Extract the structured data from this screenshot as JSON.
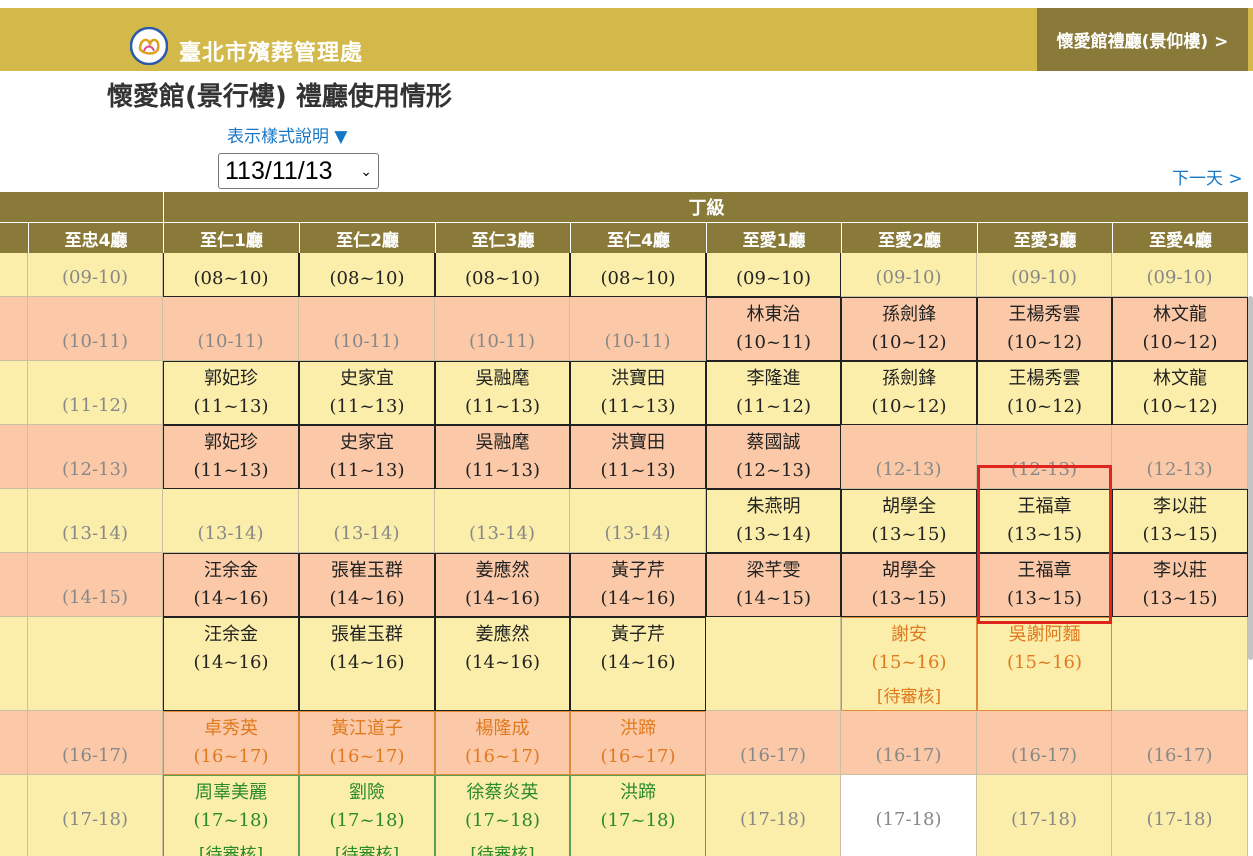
{
  "header": {
    "org_name": "臺北市殯葬管理處",
    "nav_link": "懷愛館禮廳(景仰樓) >",
    "page_title": "懷愛館(景行樓) 禮廳使用情形",
    "legend_link": "表示樣式說明 ▼",
    "date_value": "113/11/13",
    "next_day": "下一天 >"
  },
  "colors": {
    "topbar": "#d3b84a",
    "header_dark": "#8a7a3a",
    "row_yellow": "#fbeeab",
    "row_salmon": "#fbc9a8",
    "highlight": "#e0241f",
    "link": "#1677c6"
  },
  "table": {
    "grade_label": "丁級",
    "halls": [
      "至忠4廳",
      "至仁1廳",
      "至仁2廳",
      "至仁3廳",
      "至仁4廳",
      "至愛1廳",
      "至愛2廳",
      "至愛3廳",
      "至愛4廳"
    ],
    "rows": [
      {
        "bg": "yellow",
        "cells": [
          {
            "name": "",
            "time": "(09-10)",
            "style": "empty"
          },
          {
            "name": "",
            "time": "(08~10)",
            "style": "booked"
          },
          {
            "name": "",
            "time": "(08~10)",
            "style": "booked"
          },
          {
            "name": "",
            "time": "(08~10)",
            "style": "booked"
          },
          {
            "name": "",
            "time": "(08~10)",
            "style": "booked"
          },
          {
            "name": "",
            "time": "(09~10)",
            "style": "booked"
          },
          {
            "name": "",
            "time": "(09-10)",
            "style": "empty"
          },
          {
            "name": "",
            "time": "(09-10)",
            "style": "empty"
          },
          {
            "name": "",
            "time": "(09-10)",
            "style": "empty"
          }
        ]
      },
      {
        "bg": "salmon",
        "cells": [
          {
            "name": "",
            "time": "(10-11)",
            "style": "empty"
          },
          {
            "name": "",
            "time": "(10-11)",
            "style": "empty"
          },
          {
            "name": "",
            "time": "(10-11)",
            "style": "empty"
          },
          {
            "name": "",
            "time": "(10-11)",
            "style": "empty"
          },
          {
            "name": "",
            "time": "(10-11)",
            "style": "empty"
          },
          {
            "name": "林東治",
            "time": "(10~11)",
            "style": "booked"
          },
          {
            "name": "孫劍鋒",
            "time": "(10~12)",
            "style": "booked"
          },
          {
            "name": "王楊秀雲",
            "time": "(10~12)",
            "style": "booked"
          },
          {
            "name": "林文龍",
            "time": "(10~12)",
            "style": "booked"
          }
        ]
      },
      {
        "bg": "yellow",
        "cells": [
          {
            "name": "",
            "time": "(11-12)",
            "style": "empty"
          },
          {
            "name": "郭妃珍",
            "time": "(11~13)",
            "style": "booked"
          },
          {
            "name": "史家宜",
            "time": "(11~13)",
            "style": "booked"
          },
          {
            "name": "吳融麾",
            "time": "(11~13)",
            "style": "booked"
          },
          {
            "name": "洪寶田",
            "time": "(11~13)",
            "style": "booked"
          },
          {
            "name": "李隆進",
            "time": "(11~12)",
            "style": "booked"
          },
          {
            "name": "孫劍鋒",
            "time": "(10~12)",
            "style": "booked"
          },
          {
            "name": "王楊秀雲",
            "time": "(10~12)",
            "style": "booked"
          },
          {
            "name": "林文龍",
            "time": "(10~12)",
            "style": "booked"
          }
        ]
      },
      {
        "bg": "salmon",
        "cells": [
          {
            "name": "",
            "time": "(12-13)",
            "style": "empty"
          },
          {
            "name": "郭妃珍",
            "time": "(11~13)",
            "style": "booked"
          },
          {
            "name": "史家宜",
            "time": "(11~13)",
            "style": "booked"
          },
          {
            "name": "吳融麾",
            "time": "(11~13)",
            "style": "booked"
          },
          {
            "name": "洪寶田",
            "time": "(11~13)",
            "style": "booked"
          },
          {
            "name": "蔡國誠",
            "time": "(12~13)",
            "style": "booked"
          },
          {
            "name": "",
            "time": "(12-13)",
            "style": "empty"
          },
          {
            "name": "",
            "time": "(12-13)",
            "style": "empty"
          },
          {
            "name": "",
            "time": "(12-13)",
            "style": "empty"
          }
        ]
      },
      {
        "bg": "yellow",
        "cells": [
          {
            "name": "",
            "time": "(13-14)",
            "style": "empty"
          },
          {
            "name": "",
            "time": "(13-14)",
            "style": "empty"
          },
          {
            "name": "",
            "time": "(13-14)",
            "style": "empty"
          },
          {
            "name": "",
            "time": "(13-14)",
            "style": "empty"
          },
          {
            "name": "",
            "time": "(13-14)",
            "style": "empty"
          },
          {
            "name": "朱燕明",
            "time": "(13~14)",
            "style": "booked"
          },
          {
            "name": "胡學全",
            "time": "(13~15)",
            "style": "booked"
          },
          {
            "name": "王福章",
            "time": "(13~15)",
            "style": "booked"
          },
          {
            "name": "李以莊",
            "time": "(13~15)",
            "style": "booked"
          }
        ]
      },
      {
        "bg": "salmon",
        "cells": [
          {
            "name": "",
            "time": "(14-15)",
            "style": "empty"
          },
          {
            "name": "汪余金",
            "time": "(14~16)",
            "style": "booked"
          },
          {
            "name": "張崔玉群",
            "time": "(14~16)",
            "style": "booked"
          },
          {
            "name": "姜應然",
            "time": "(14~16)",
            "style": "booked"
          },
          {
            "name": "黃子芹",
            "time": "(14~16)",
            "style": "booked"
          },
          {
            "name": "梁芊雯",
            "time": "(14~15)",
            "style": "booked"
          },
          {
            "name": "胡學全",
            "time": "(13~15)",
            "style": "booked"
          },
          {
            "name": "王福章",
            "time": "(13~15)",
            "style": "booked"
          },
          {
            "name": "李以莊",
            "time": "(13~15)",
            "style": "booked"
          }
        ]
      },
      {
        "bg": "yellow",
        "tall": true,
        "cells": [
          {
            "name": "",
            "time": "",
            "style": "empty"
          },
          {
            "name": "汪余金",
            "time": "(14~16)",
            "style": "booked"
          },
          {
            "name": "張崔玉群",
            "time": "(14~16)",
            "style": "booked"
          },
          {
            "name": "姜應然",
            "time": "(14~16)",
            "style": "booked"
          },
          {
            "name": "黃子芹",
            "time": "(14~16)",
            "style": "booked"
          },
          {
            "name": "",
            "time": "",
            "style": "empty"
          },
          {
            "name": "謝安",
            "time": "(15~16)",
            "style": "pending",
            "status": "[待審核]"
          },
          {
            "name": "吳謝阿麵",
            "time": "(15~16)",
            "style": "pending"
          },
          {
            "name": "",
            "time": "",
            "style": "empty"
          }
        ]
      },
      {
        "bg": "salmon",
        "cells": [
          {
            "name": "",
            "time": "(16-17)",
            "style": "empty"
          },
          {
            "name": "卓秀英",
            "time": "(16~17)",
            "style": "pending"
          },
          {
            "name": "黃江道子",
            "time": "(16~17)",
            "style": "pending"
          },
          {
            "name": "楊隆成",
            "time": "(16~17)",
            "style": "pending"
          },
          {
            "name": "洪蹄",
            "time": "(16~17)",
            "style": "pending"
          },
          {
            "name": "",
            "time": "(16-17)",
            "style": "empty"
          },
          {
            "name": "",
            "time": "(16-17)",
            "style": "empty"
          },
          {
            "name": "",
            "time": "(16-17)",
            "style": "empty"
          },
          {
            "name": "",
            "time": "(16-17)",
            "style": "empty"
          }
        ]
      },
      {
        "bg": "yellow",
        "tall": true,
        "cells": [
          {
            "name": "",
            "time": "(17-18)",
            "style": "empty"
          },
          {
            "name": "周辜美麗",
            "time": "(17~18)",
            "style": "green",
            "status": "[待審核]"
          },
          {
            "name": "劉險",
            "time": "(17~18)",
            "style": "green",
            "status": "[待審核]"
          },
          {
            "name": "徐蔡炎英",
            "time": "(17~18)",
            "style": "green",
            "status": "[待審核]"
          },
          {
            "name": "洪蹄",
            "time": "(17~18)",
            "style": "green"
          },
          {
            "name": "",
            "time": "(17-18)",
            "style": "empty"
          },
          {
            "name": "",
            "time": "(17-18)",
            "style": "empty",
            "white": true
          },
          {
            "name": "",
            "time": "(17-18)",
            "style": "empty"
          },
          {
            "name": "",
            "time": "(17-18)",
            "style": "empty"
          }
        ]
      }
    ]
  }
}
